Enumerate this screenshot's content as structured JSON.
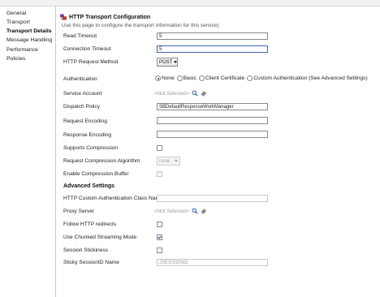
{
  "sidebar": {
    "items": [
      {
        "label": "General"
      },
      {
        "label": "Transport"
      },
      {
        "label": "Transport Details",
        "active": true
      },
      {
        "label": "Message Handling"
      },
      {
        "label": "Performance"
      },
      {
        "label": "Policies"
      }
    ]
  },
  "header": {
    "title": "HTTP Transport Configuration",
    "description": "Use this page to configure the transport information for this service)"
  },
  "form": {
    "read_timeout": {
      "label": "Read Timeout",
      "value": "5"
    },
    "connection_timeout": {
      "label": "Connection Timeout",
      "value": "5"
    },
    "http_request_method": {
      "label": "HTTP Request Method",
      "value": "POST"
    },
    "authentication": {
      "label": "Authentication",
      "options": [
        "None",
        "Basic",
        "Client Certificate",
        "Custom Authentication (See Advanced Settings)"
      ],
      "selected": "None"
    },
    "service_account": {
      "label": "Service Account",
      "value": "<Not Selected>"
    },
    "dispatch_policy": {
      "label": "Dispatch Policy",
      "value": "SBDefaultResponseWorkManager"
    },
    "request_encoding": {
      "label": "Request Encoding",
      "value": ""
    },
    "response_encoding": {
      "label": "Response Encoding",
      "value": ""
    },
    "supports_compression": {
      "label": "Supports Compression",
      "checked": false
    },
    "request_compression_algorithm": {
      "label": "Request Compression Algorithm",
      "value": "none"
    },
    "enable_compression_buffer": {
      "label": "Enable Compression Buffer",
      "checked": false
    }
  },
  "advanced": {
    "heading": "Advanced Settings",
    "custom_auth_class": {
      "label": "HTTP Custom Authentication Class Name",
      "value": ""
    },
    "proxy_server": {
      "label": "Proxy Server",
      "value": "<Not Selected>"
    },
    "follow_redirects": {
      "label": "Follow HTTP redirects",
      "checked": false
    },
    "chunked_streaming": {
      "label": "Use Chunked Streaming Mode",
      "checked": true
    },
    "session_stickiness": {
      "label": "Session Stickiness",
      "checked": false
    },
    "sticky_session_id": {
      "label": "Sticky SessionID Name",
      "value": "JSESSIONID"
    }
  },
  "icons": {
    "title_icon": "transport-config-icon",
    "search": "search-icon",
    "clear": "eraser-icon"
  },
  "colors": {
    "accent": "#1c3f8a",
    "focus_border": "#3a66b5",
    "divider": "#c9c9c9"
  }
}
